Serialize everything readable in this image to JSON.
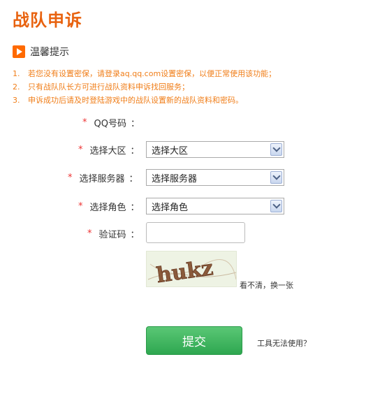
{
  "page": {
    "title": "战队申诉"
  },
  "tips": {
    "heading": "温馨提示",
    "items": [
      {
        "num": "1.",
        "text": "若您没有设置密保，请登录aq.qq.com设置密保，以便正常使用该功能；"
      },
      {
        "num": "2.",
        "text": "只有战队队长方可进行战队资料申诉找回服务；"
      },
      {
        "num": "3.",
        "text": "申诉成功后请及时登陆游戏中的战队设置新的战队资料和密码。"
      }
    ]
  },
  "form": {
    "required_mark": "*",
    "qq_label": "QQ号码",
    "region_label": "选择大区",
    "region_value": "选择大区",
    "server_label": "选择服务器",
    "server_value": "选择服务器",
    "role_label": "选择角色",
    "role_value": "选择角色",
    "captcha_label": "验证码",
    "colon": "：",
    "captcha_text": "hukz",
    "refresh_label": "看不清，换一张",
    "submit_label": "提交",
    "help_link": "工具无法使用？"
  },
  "colors": {
    "accent": "#e8620f",
    "tip_text": "#f07e19",
    "required": "#ee3333",
    "submit": "#3bb35c"
  }
}
